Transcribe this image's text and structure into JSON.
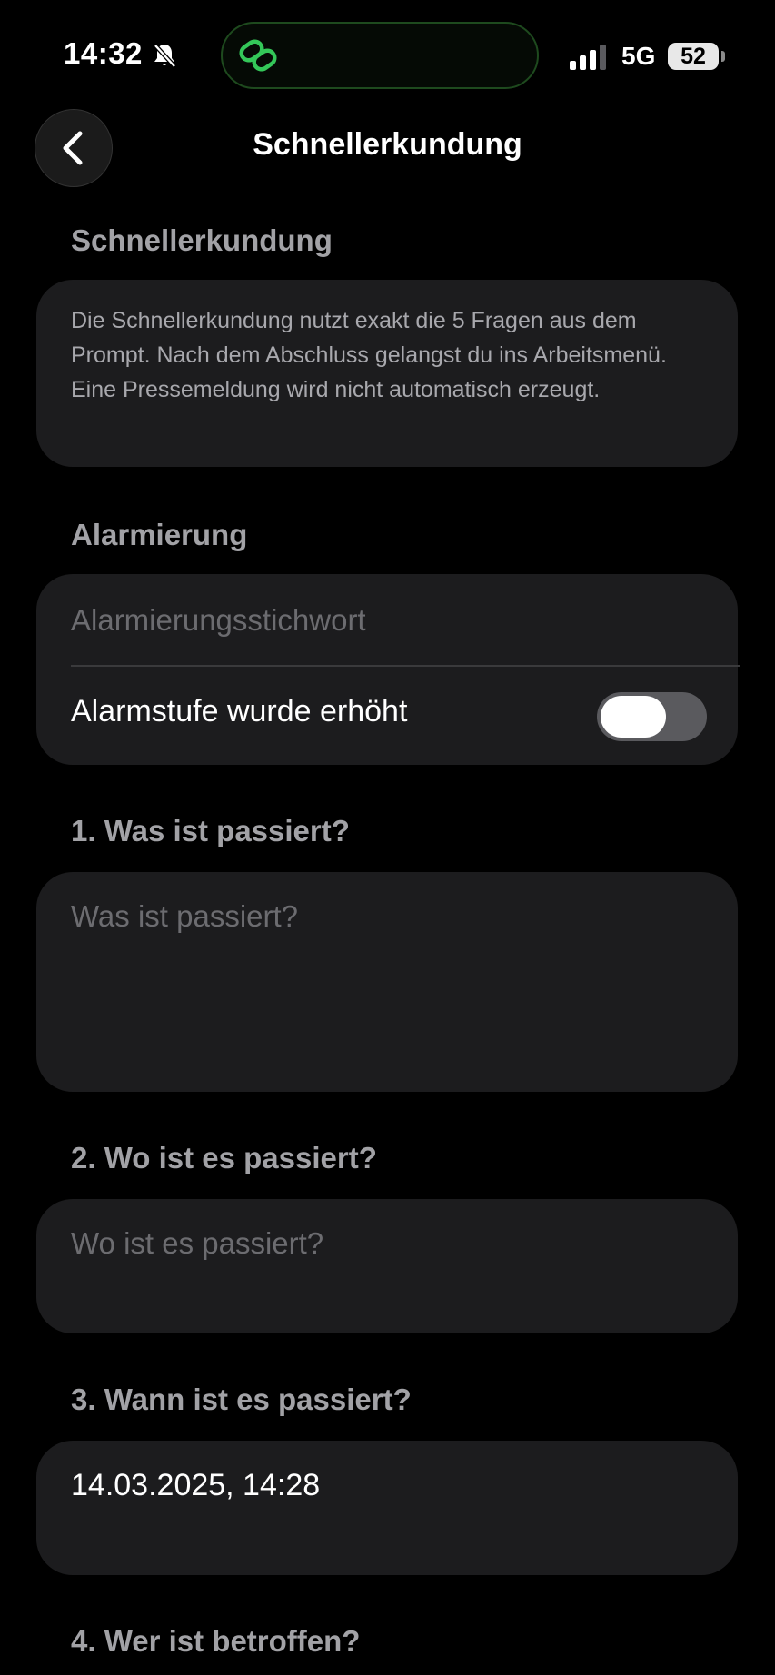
{
  "status_bar": {
    "time": "14:32",
    "network": "5G",
    "battery": "52"
  },
  "icons": {
    "back": "chevron-left-icon",
    "bell": "bell-slash-icon",
    "island": "link-icon",
    "signal": "cellular-signal-icon"
  },
  "colors": {
    "accent": "#34c759",
    "card": "#1c1c1e",
    "section_header": "#a2a2a6"
  },
  "nav": {
    "title": "Schnellerkundung"
  },
  "sections": {
    "intro": {
      "header": "Schnellerkundung",
      "text": "Die Schnellerkundung nutzt exakt die 5 Fragen aus dem Prompt. Nach dem Abschluss gelangst du ins Arbeitsmenü. Eine Pressemeldung wird nicht automatisch erzeugt."
    },
    "alarm": {
      "header": "Alarmierung",
      "keyword_placeholder": "Alarmierungsstichwort",
      "toggle_label": "Alarmstufe wurde erhöht",
      "toggle_on": false
    },
    "q1": {
      "header": "1. Was ist passiert?",
      "placeholder": "Was ist passiert?"
    },
    "q2": {
      "header": "2. Wo ist es passiert?",
      "placeholder": "Wo ist es passiert?"
    },
    "q3": {
      "header": "3. Wann ist es passiert?",
      "value": "14.03.2025, 14:28"
    },
    "q4": {
      "header": "4. Wer ist betroffen?"
    }
  }
}
